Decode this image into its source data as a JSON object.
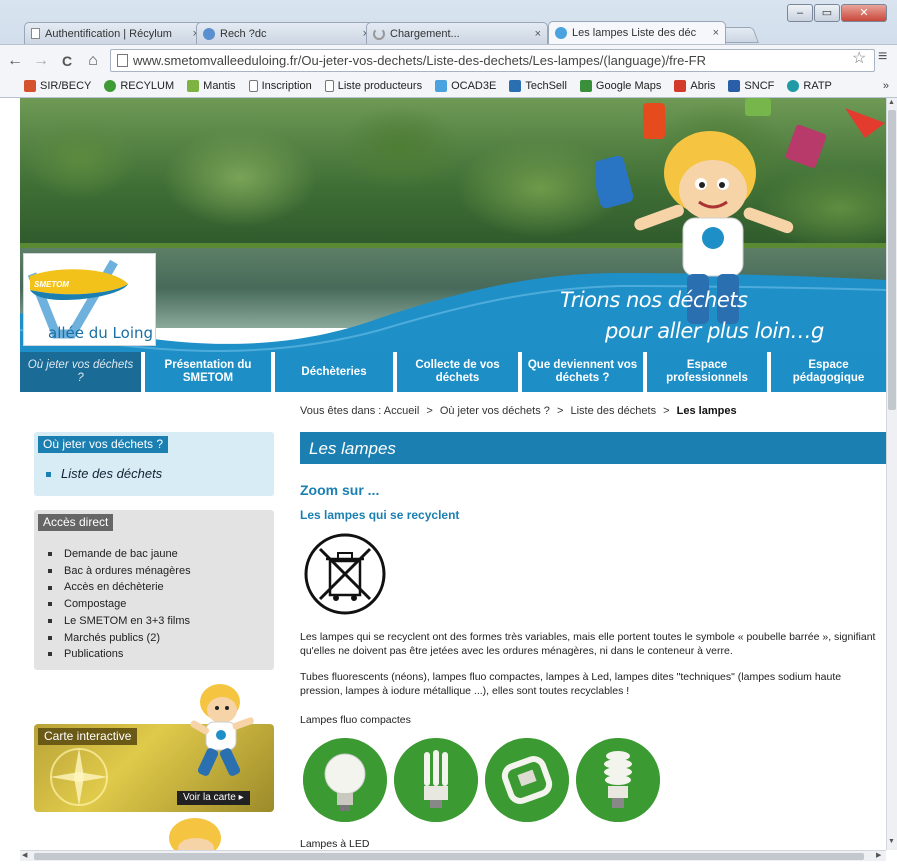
{
  "browser": {
    "tabs": [
      {
        "title": "Authentification | Récylum",
        "close": "×"
      },
      {
        "title": "Rech ?dc",
        "close": "×"
      },
      {
        "title": "Chargement...",
        "close": "×"
      },
      {
        "title": "Les lampes   Liste des déc",
        "close": "×"
      }
    ],
    "window_buttons": {
      "minimize": "–",
      "restore": "▭",
      "close": "✕"
    },
    "nav": {
      "back": "←",
      "forward": "→",
      "reload": "C",
      "home": "⌂"
    },
    "url": "www.smetomvalleeduloing.fr/Ou-jeter-vos-dechets/Liste-des-dechets/Les-lampes/(language)/fre-FR",
    "bookmarks": [
      {
        "label": "SIR/BECY",
        "color": "#d4522e"
      },
      {
        "label": "RECYLUM",
        "color": "#3f9b35"
      },
      {
        "label": "Mantis",
        "color": "#7cb342"
      },
      {
        "label": "Inscription",
        "color": "#ffffff"
      },
      {
        "label": "Liste producteurs",
        "color": "#ffffff"
      },
      {
        "label": "OCAD3E",
        "color": "#4aa3df"
      },
      {
        "label": "TechSell",
        "color": "#2a6fb0"
      },
      {
        "label": "Google Maps",
        "color": "#3a8f3a"
      },
      {
        "label": "Abris",
        "color": "#d33a2c"
      },
      {
        "label": "SNCF",
        "color": "#2b5ea8"
      },
      {
        "label": "RATP",
        "color": "#1f9aa6"
      }
    ],
    "bookmarks_more": "»"
  },
  "site": {
    "logo": {
      "top": "SMETOM",
      "bottom": "allée du Loing"
    },
    "slogan_line1": "Trions nos déchets",
    "slogan_line2": "pour aller plus loin…g",
    "nav": [
      {
        "label": "Où jeter vos déchets ?",
        "active": true
      },
      {
        "label": "Présentation du SMETOM"
      },
      {
        "label": "Déchèteries"
      },
      {
        "label": "Collecte de vos déchets"
      },
      {
        "label": "Que deviennent vos déchets ?"
      },
      {
        "label": "Espace professionnels"
      },
      {
        "label": "Espace pédagogique"
      }
    ],
    "breadcrumb": {
      "prefix": "Vous êtes dans :",
      "items": [
        "Accueil",
        "Où jeter vos déchets ?",
        "Liste des déchets"
      ],
      "current": "Les lampes",
      "separator": ">"
    },
    "sidebar": {
      "ou_jeter": {
        "title": "Où jeter vos déchets ?",
        "item": "Liste des déchets"
      },
      "acces_direct": {
        "title": "Accès direct",
        "items": [
          "Demande de bac jaune",
          "Bac à ordures ménagères",
          "Accès en déchèterie",
          "Compostage",
          "Le SMETOM en 3+3 films",
          "Marchés publics (2)",
          "Publications"
        ]
      },
      "carte": {
        "title": "Carte interactive",
        "button": "Voir la carte ▸"
      }
    },
    "content": {
      "title": "Les lampes",
      "zoom": "Zoom sur ...",
      "subtitle": "Les lampes qui se recyclent",
      "para1": "Les lampes qui se recyclent ont des formes très variables, mais elle portent toutes le symbole « poubelle barrée », signifiant qu'elles ne doivent pas être jetées avec les ordures ménagères, ni dans le conteneur à verre.",
      "para2": "Tubes fluorescents (néons), lampes fluo compactes, lampes à Led, lampes dites \"techniques\" (lampes sodium haute pression, lampes à iodure métallique ...), elles sont toutes recyclables !",
      "section_fluo": "Lampes fluo compactes",
      "section_led": "Lampes à LED"
    }
  },
  "colors": {
    "accent": "#1b7fb2",
    "nav": "#1e8fc6",
    "lamp_green": "#3c9a33",
    "sidebar_blue": "#d8ecf5"
  }
}
